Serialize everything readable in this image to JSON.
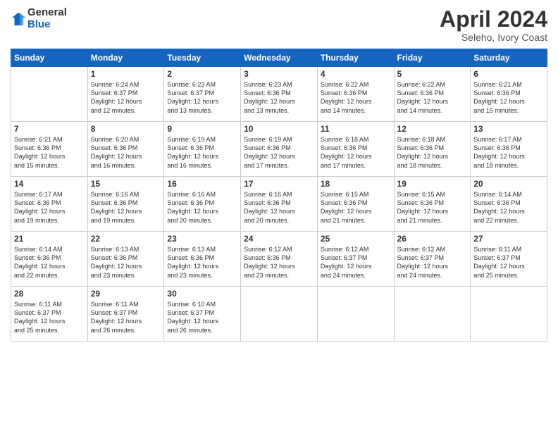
{
  "logo": {
    "general": "General",
    "blue": "Blue"
  },
  "title": "April 2024",
  "subtitle": "Seleho, Ivory Coast",
  "days_of_week": [
    "Sunday",
    "Monday",
    "Tuesday",
    "Wednesday",
    "Thursday",
    "Friday",
    "Saturday"
  ],
  "weeks": [
    [
      {
        "day": "",
        "info": ""
      },
      {
        "day": "1",
        "info": "Sunrise: 6:24 AM\nSunset: 6:37 PM\nDaylight: 12 hours\nand 12 minutes."
      },
      {
        "day": "2",
        "info": "Sunrise: 6:23 AM\nSunset: 6:37 PM\nDaylight: 12 hours\nand 13 minutes."
      },
      {
        "day": "3",
        "info": "Sunrise: 6:23 AM\nSunset: 6:36 PM\nDaylight: 12 hours\nand 13 minutes."
      },
      {
        "day": "4",
        "info": "Sunrise: 6:22 AM\nSunset: 6:36 PM\nDaylight: 12 hours\nand 14 minutes."
      },
      {
        "day": "5",
        "info": "Sunrise: 6:22 AM\nSunset: 6:36 PM\nDaylight: 12 hours\nand 14 minutes."
      },
      {
        "day": "6",
        "info": "Sunrise: 6:21 AM\nSunset: 6:36 PM\nDaylight: 12 hours\nand 15 minutes."
      }
    ],
    [
      {
        "day": "7",
        "info": "Sunrise: 6:21 AM\nSunset: 6:36 PM\nDaylight: 12 hours\nand 15 minutes."
      },
      {
        "day": "8",
        "info": "Sunrise: 6:20 AM\nSunset: 6:36 PM\nDaylight: 12 hours\nand 16 minutes."
      },
      {
        "day": "9",
        "info": "Sunrise: 6:19 AM\nSunset: 6:36 PM\nDaylight: 12 hours\nand 16 minutes."
      },
      {
        "day": "10",
        "info": "Sunrise: 6:19 AM\nSunset: 6:36 PM\nDaylight: 12 hours\nand 17 minutes."
      },
      {
        "day": "11",
        "info": "Sunrise: 6:18 AM\nSunset: 6:36 PM\nDaylight: 12 hours\nand 17 minutes."
      },
      {
        "day": "12",
        "info": "Sunrise: 6:18 AM\nSunset: 6:36 PM\nDaylight: 12 hours\nand 18 minutes."
      },
      {
        "day": "13",
        "info": "Sunrise: 6:17 AM\nSunset: 6:36 PM\nDaylight: 12 hours\nand 18 minutes."
      }
    ],
    [
      {
        "day": "14",
        "info": "Sunrise: 6:17 AM\nSunset: 6:36 PM\nDaylight: 12 hours\nand 19 minutes."
      },
      {
        "day": "15",
        "info": "Sunrise: 6:16 AM\nSunset: 6:36 PM\nDaylight: 12 hours\nand 19 minutes."
      },
      {
        "day": "16",
        "info": "Sunrise: 6:16 AM\nSunset: 6:36 PM\nDaylight: 12 hours\nand 20 minutes."
      },
      {
        "day": "17",
        "info": "Sunrise: 6:16 AM\nSunset: 6:36 PM\nDaylight: 12 hours\nand 20 minutes."
      },
      {
        "day": "18",
        "info": "Sunrise: 6:15 AM\nSunset: 6:36 PM\nDaylight: 12 hours\nand 21 minutes."
      },
      {
        "day": "19",
        "info": "Sunrise: 6:15 AM\nSunset: 6:36 PM\nDaylight: 12 hours\nand 21 minutes."
      },
      {
        "day": "20",
        "info": "Sunrise: 6:14 AM\nSunset: 6:36 PM\nDaylight: 12 hours\nand 22 minutes."
      }
    ],
    [
      {
        "day": "21",
        "info": "Sunrise: 6:14 AM\nSunset: 6:36 PM\nDaylight: 12 hours\nand 22 minutes."
      },
      {
        "day": "22",
        "info": "Sunrise: 6:13 AM\nSunset: 6:36 PM\nDaylight: 12 hours\nand 23 minutes."
      },
      {
        "day": "23",
        "info": "Sunrise: 6:13 AM\nSunset: 6:36 PM\nDaylight: 12 hours\nand 23 minutes."
      },
      {
        "day": "24",
        "info": "Sunrise: 6:12 AM\nSunset: 6:36 PM\nDaylight: 12 hours\nand 23 minutes."
      },
      {
        "day": "25",
        "info": "Sunrise: 6:12 AM\nSunset: 6:37 PM\nDaylight: 12 hours\nand 24 minutes."
      },
      {
        "day": "26",
        "info": "Sunrise: 6:12 AM\nSunset: 6:37 PM\nDaylight: 12 hours\nand 24 minutes."
      },
      {
        "day": "27",
        "info": "Sunrise: 6:11 AM\nSunset: 6:37 PM\nDaylight: 12 hours\nand 25 minutes."
      }
    ],
    [
      {
        "day": "28",
        "info": "Sunrise: 6:11 AM\nSunset: 6:37 PM\nDaylight: 12 hours\nand 25 minutes."
      },
      {
        "day": "29",
        "info": "Sunrise: 6:11 AM\nSunset: 6:37 PM\nDaylight: 12 hours\nand 26 minutes."
      },
      {
        "day": "30",
        "info": "Sunrise: 6:10 AM\nSunset: 6:37 PM\nDaylight: 12 hours\nand 26 minutes."
      },
      {
        "day": "",
        "info": ""
      },
      {
        "day": "",
        "info": ""
      },
      {
        "day": "",
        "info": ""
      },
      {
        "day": "",
        "info": ""
      }
    ]
  ]
}
